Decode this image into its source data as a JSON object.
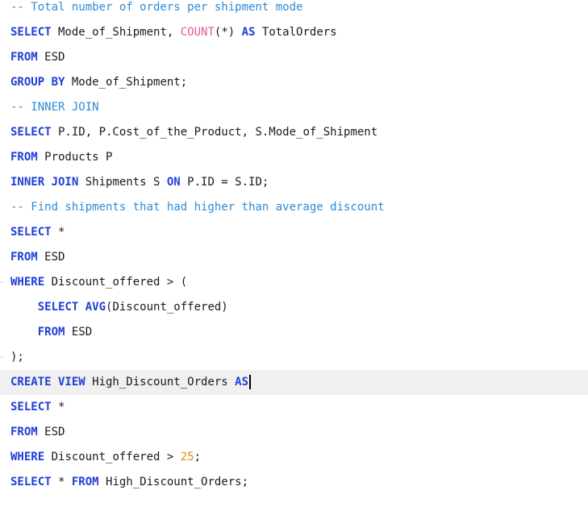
{
  "colors": {
    "keyword": "#1f3fd6",
    "function": "#e05a9a",
    "comment": "#2e8bd6",
    "number": "#e08a1a",
    "text": "#1a1a1a",
    "current_line": "#f0f0f0"
  },
  "code": [
    [
      {
        "t": "-- Total number of orders per shipment mode",
        "c": "cm"
      }
    ],
    [
      {
        "t": "SELECT",
        "c": "kw"
      },
      {
        "t": " Mode_of_Shipment, "
      },
      {
        "t": "COUNT",
        "c": "fn"
      },
      {
        "t": "(*) "
      },
      {
        "t": "AS",
        "c": "kw"
      },
      {
        "t": " TotalOrders"
      }
    ],
    [
      {
        "t": "FROM",
        "c": "kw"
      },
      {
        "t": " ESD"
      }
    ],
    [
      {
        "t": "GROUP BY",
        "c": "kw"
      },
      {
        "t": " Mode_of_Shipment;"
      }
    ],
    [
      {
        "t": "-- INNER JOIN",
        "c": "cm"
      }
    ],
    [
      {
        "t": "SELECT",
        "c": "kw"
      },
      {
        "t": " P.ID, P.Cost_of_the_Product, S.Mode_of_Shipment"
      }
    ],
    [
      {
        "t": "FROM",
        "c": "kw"
      },
      {
        "t": " Products P"
      }
    ],
    [
      {
        "t": "INNER JOIN",
        "c": "kw"
      },
      {
        "t": " Shipments S "
      },
      {
        "t": "ON",
        "c": "kw"
      },
      {
        "t": " P.ID = S.ID;"
      }
    ],
    [
      {
        "t": "-- Find shipments that had higher than average discount",
        "c": "cm"
      }
    ],
    [
      {
        "t": "SELECT",
        "c": "kw"
      },
      {
        "t": " *"
      }
    ],
    [
      {
        "t": "FROM",
        "c": "kw"
      },
      {
        "t": " ESD"
      }
    ],
    [
      {
        "t": "WHERE",
        "c": "kw"
      },
      {
        "t": " Discount_offered > ("
      }
    ],
    [
      {
        "t": "    "
      },
      {
        "t": "SELECT AVG",
        "c": "kw"
      },
      {
        "t": "(Discount_offered)"
      }
    ],
    [
      {
        "t": "    "
      },
      {
        "t": "FROM",
        "c": "kw"
      },
      {
        "t": " ESD"
      }
    ],
    [
      {
        "t": ");"
      }
    ],
    [
      {
        "t": "CREATE VIEW",
        "c": "kw"
      },
      {
        "t": " High_Discount_Orders "
      },
      {
        "t": "AS",
        "c": "kw"
      }
    ],
    [
      {
        "t": "SELECT",
        "c": "kw"
      },
      {
        "t": " *"
      }
    ],
    [
      {
        "t": "FROM",
        "c": "kw"
      },
      {
        "t": " ESD"
      }
    ],
    [
      {
        "t": "WHERE",
        "c": "kw"
      },
      {
        "t": " Discount_offered > "
      },
      {
        "t": "25",
        "c": "num"
      },
      {
        "t": ";"
      }
    ],
    [
      {
        "t": "SELECT",
        "c": "kw"
      },
      {
        "t": " * "
      },
      {
        "t": "FROM",
        "c": "kw"
      },
      {
        "t": " High_Discount_Orders;"
      }
    ]
  ],
  "current_line_index": 15,
  "fold_marker_lines": [
    11,
    14
  ]
}
